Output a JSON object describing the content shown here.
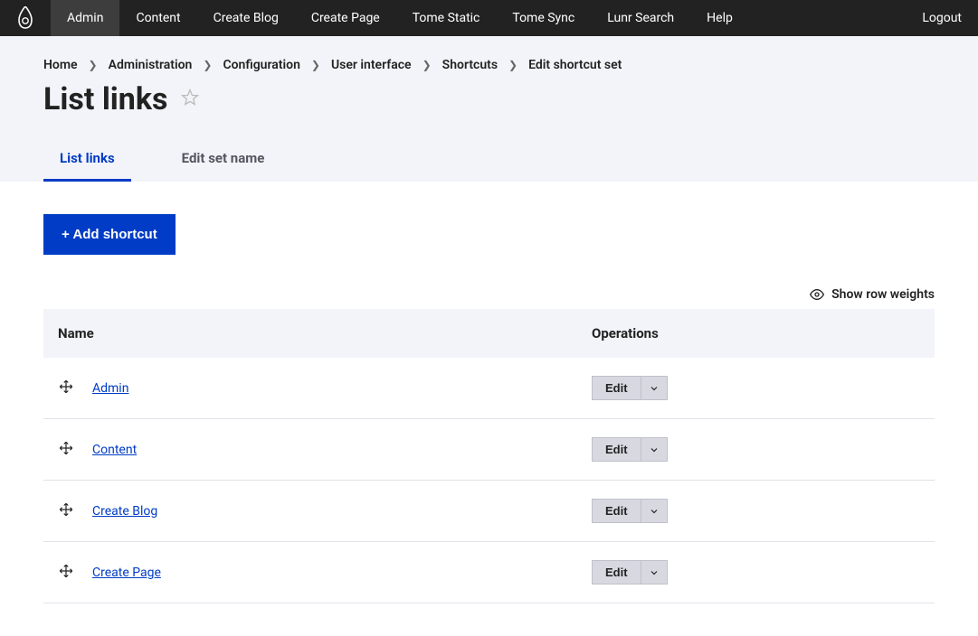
{
  "toolbar": {
    "items": [
      "Admin",
      "Content",
      "Create Blog",
      "Create Page",
      "Tome Static",
      "Tome Sync",
      "Lunr Search",
      "Help"
    ],
    "logout": "Logout"
  },
  "breadcrumb": [
    "Home",
    "Administration",
    "Configuration",
    "User interface",
    "Shortcuts",
    "Edit shortcut set"
  ],
  "page_title": "List links",
  "tabs": [
    {
      "label": "List links",
      "active": true
    },
    {
      "label": "Edit set name",
      "active": false
    }
  ],
  "add_button": "+ Add shortcut",
  "show_weights": "Show row weights",
  "table": {
    "headers": {
      "name": "Name",
      "operations": "Operations"
    },
    "rows": [
      {
        "name": "Admin",
        "op": "Edit"
      },
      {
        "name": "Content",
        "op": "Edit"
      },
      {
        "name": "Create Blog",
        "op": "Edit"
      },
      {
        "name": "Create Page",
        "op": "Edit"
      }
    ]
  }
}
